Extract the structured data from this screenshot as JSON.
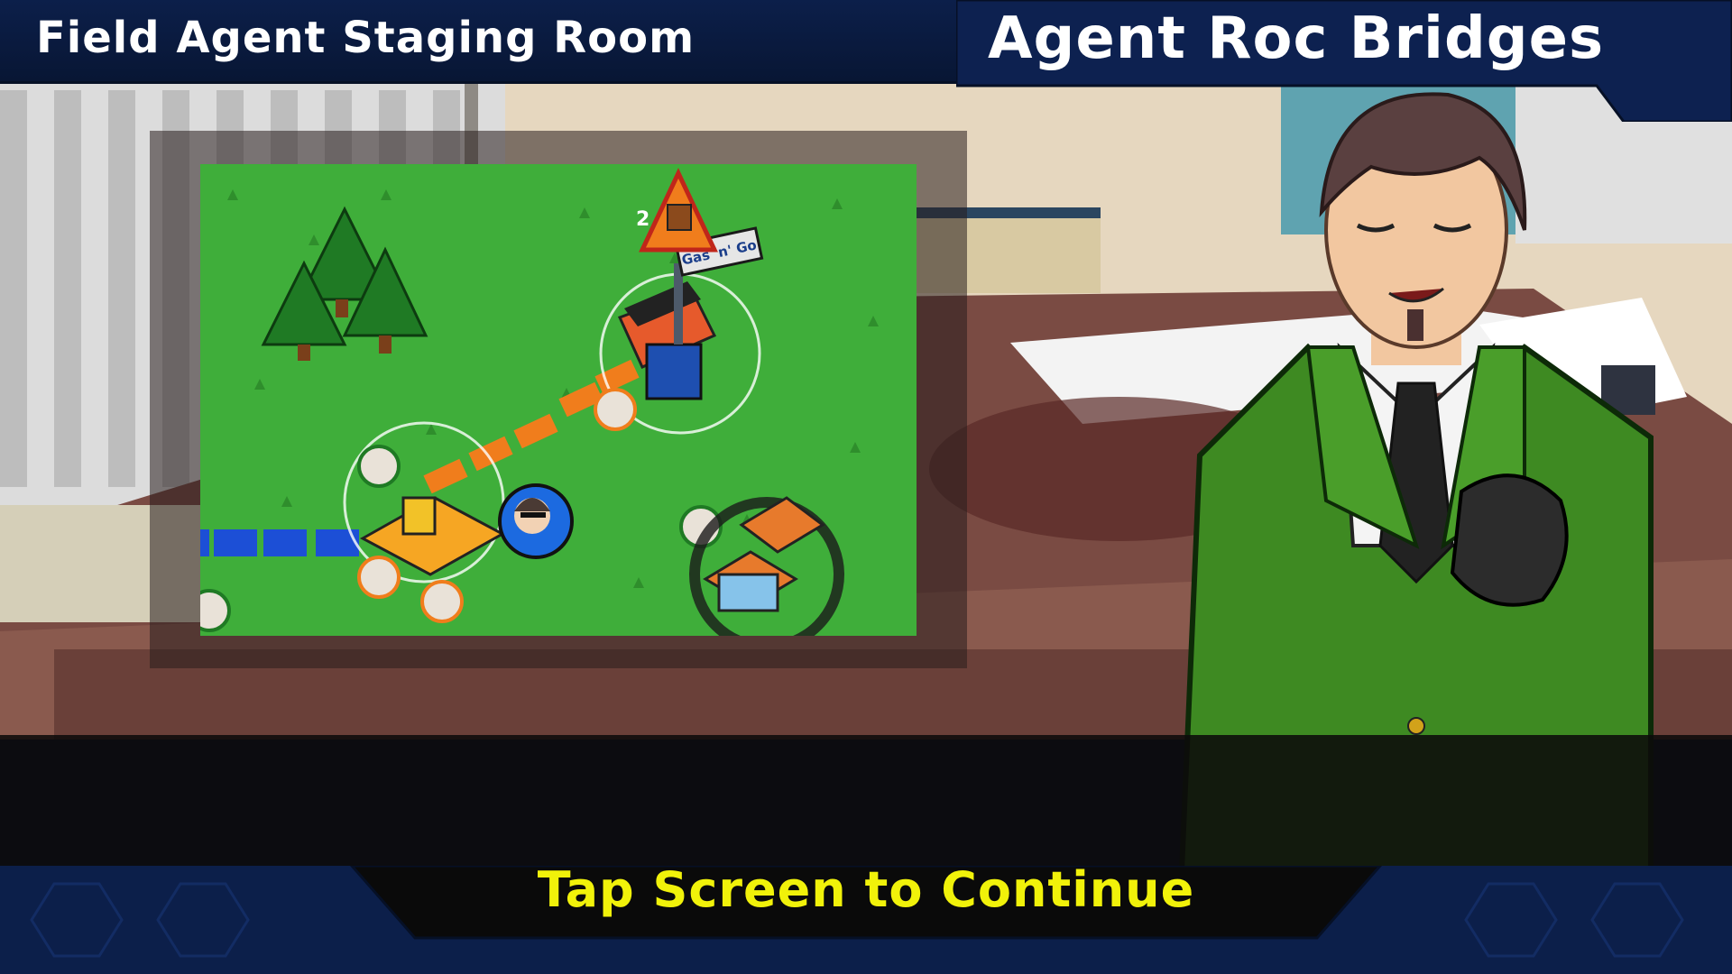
{
  "header": {
    "room_title": "Field Agent Staging Room",
    "agent_name": "Agent Roc Bridges"
  },
  "map": {
    "landmark_sign": "Gas 'n' Go",
    "warning_count": "2"
  },
  "prompt": {
    "continue": "Tap Screen to Continue"
  },
  "colors": {
    "header_bg": "#0c1f4a",
    "prompt_text": "#f1f20a",
    "suit_green": "#3e8a22",
    "grass": "#3fae3a",
    "road_orange": "#f07d1c",
    "water_blue": "#1c4fd6"
  }
}
